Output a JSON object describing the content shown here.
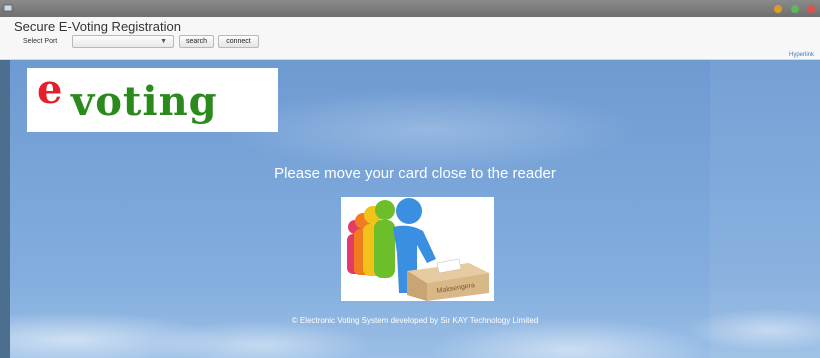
{
  "window": {
    "title": "Secure E-Voting Registration"
  },
  "toolbar": {
    "port_label": "Select Port",
    "port_selected": "",
    "search_label": "search",
    "connect_label": "connect",
    "hyperlink": "Hyperlink"
  },
  "logo": {
    "first_letter": "e",
    "rest": "voting"
  },
  "main": {
    "prompt": "Please move your card close to the reader",
    "illustration_label": "Maksengera",
    "footer": "© Electronic Voting System developed by Sir KAY Technology Limited"
  },
  "colors": {
    "logo_e": "#e4202a",
    "logo_text": "#2a8a1c",
    "background": "#7aa6da"
  }
}
